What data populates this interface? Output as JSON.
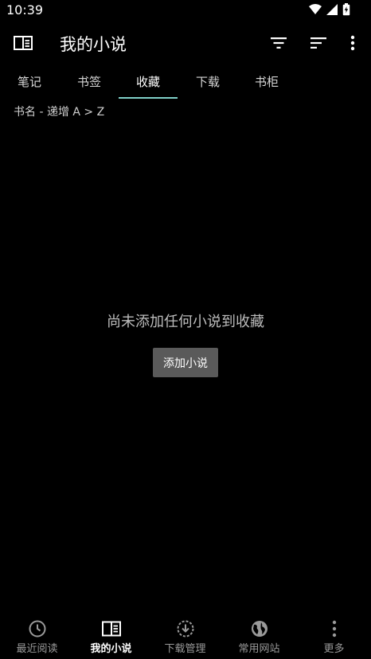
{
  "status_bar": {
    "time": "10:39"
  },
  "app_bar": {
    "title": "我的小说",
    "icons": [
      "book-open-icon",
      "filter-icon",
      "sort-icon",
      "more-vert-icon"
    ]
  },
  "tabs": [
    {
      "label": "笔记"
    },
    {
      "label": "书签"
    },
    {
      "label": "收藏",
      "active": true
    },
    {
      "label": "下载"
    },
    {
      "label": "书柜"
    }
  ],
  "sort_label": "书名 - 递增 A > Z",
  "empty_state": {
    "message": "尚未添加任何小说到收藏",
    "button_label": "添加小说"
  },
  "bottom_nav": [
    {
      "label": "最近阅读",
      "icon": "clock-icon"
    },
    {
      "label": "我的小说",
      "icon": "book-open-icon",
      "active": true
    },
    {
      "label": "下载管理",
      "icon": "download-icon"
    },
    {
      "label": "常用网站",
      "icon": "globe-icon"
    },
    {
      "label": "更多",
      "icon": "more-vert-icon"
    }
  ],
  "colors": {
    "background": "#000000",
    "tab_indicator": "#7fd0c8",
    "button_bg": "#5a5a5a"
  }
}
